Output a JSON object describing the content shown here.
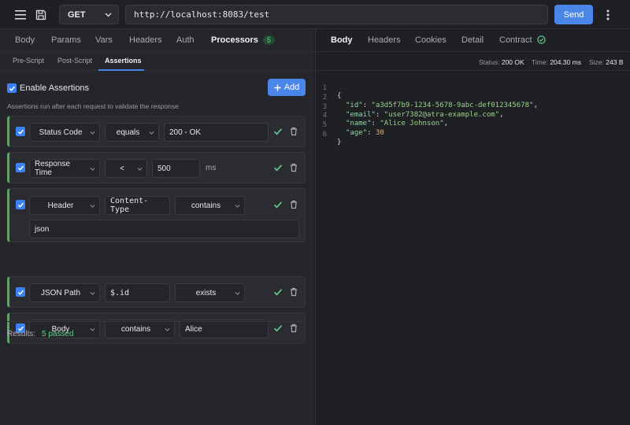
{
  "topbar": {
    "method": "GET",
    "url": "http://localhost:8083/test",
    "send_label": "Send"
  },
  "request_tabs": [
    {
      "label": "Body"
    },
    {
      "label": "Params"
    },
    {
      "label": "Vars"
    },
    {
      "label": "Headers"
    },
    {
      "label": "Auth"
    },
    {
      "label": "Processors",
      "badge": "5",
      "active": true
    }
  ],
  "sub_tabs": [
    {
      "label": "Pre-Script"
    },
    {
      "label": "Post-Script"
    },
    {
      "label": "Assertions",
      "active": true
    }
  ],
  "assertions": {
    "enable_label": "Enable Assertions",
    "enabled": true,
    "add_label": "Add",
    "help_text": "Assertions run after each request to validate the response",
    "rows": [
      {
        "type": "Status Code",
        "operator": "equals",
        "value": "200 - OK"
      },
      {
        "type": "Response Time",
        "operator": "<",
        "value": "500",
        "unit": "ms"
      },
      {
        "type": "Header",
        "property": "Content-Type",
        "operator": "contains",
        "value": "json"
      },
      {
        "type": "JSON Path",
        "property": "$.id",
        "operator": "exists"
      },
      {
        "type": "Body",
        "operator": "contains",
        "value": "Alice"
      }
    ],
    "results_label": "Results:",
    "results_value": "5 passed"
  },
  "response_tabs": [
    {
      "label": "Body",
      "active": true
    },
    {
      "label": "Headers"
    },
    {
      "label": "Cookies"
    },
    {
      "label": "Detail"
    },
    {
      "label": "Contract",
      "icon": "check-circle-icon"
    }
  ],
  "status": {
    "status_label": "Status:",
    "status_value": "200 OK",
    "time_label": "Time:",
    "time_value": "204.30 ms",
    "size_label": "Size:",
    "size_value": "243 B"
  },
  "response_body": {
    "line_numbers": [
      "1",
      "2",
      "3",
      "4",
      "5",
      "6"
    ],
    "open": "{",
    "close": "}",
    "fields": [
      {
        "key": "\"id\"",
        "value": "\"a3d5f7b9-1234-5678-9abc-def012345678\""
      },
      {
        "key": "\"email\"",
        "value": "\"user7382@atra-example.com\""
      },
      {
        "key": "\"name\"",
        "value": "\"Alice Johnson\""
      },
      {
        "key": "\"age\"",
        "value": "30"
      }
    ]
  },
  "colors": {
    "accent": "#4a86e8",
    "success": "#5fd08a",
    "background": "#1f2024"
  }
}
